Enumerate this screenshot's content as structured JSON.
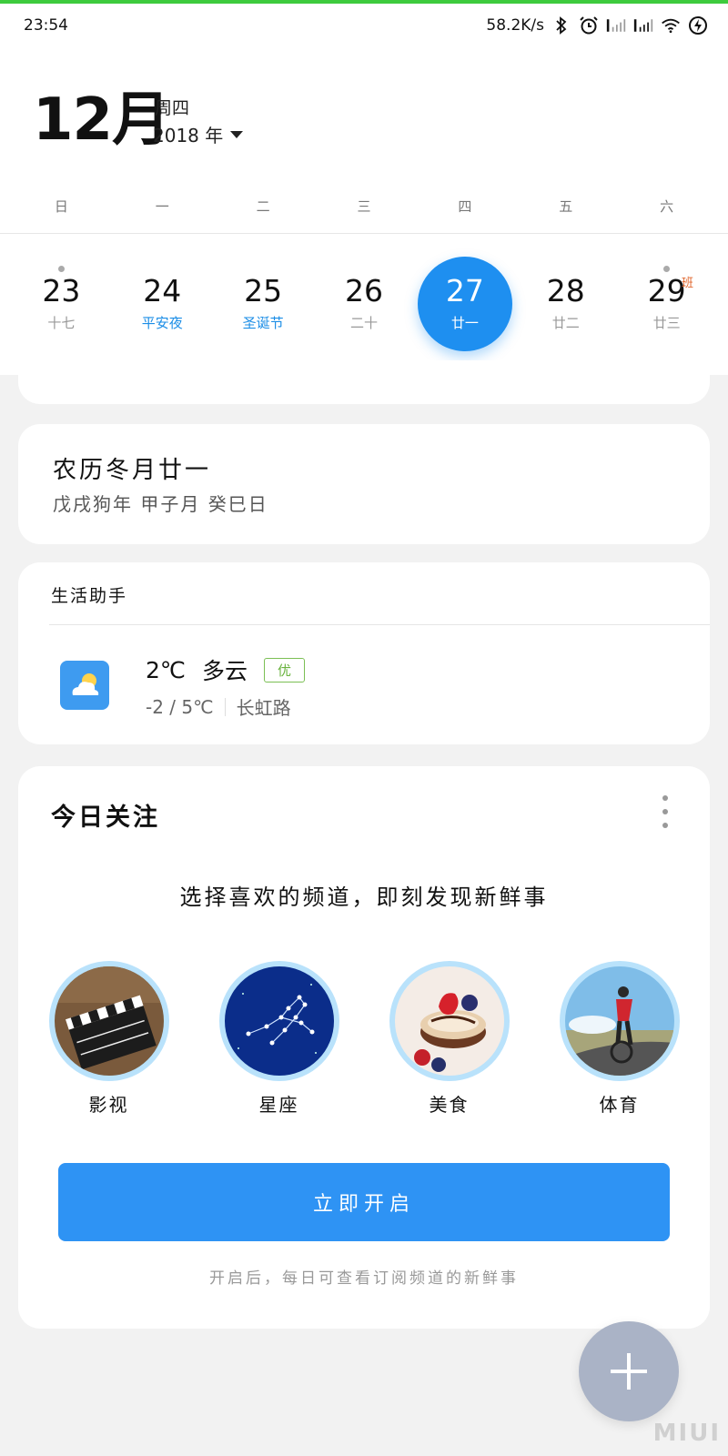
{
  "status_bar": {
    "time": "23:54",
    "net_speed": "58.2K/s",
    "icons": [
      "bluetooth-icon",
      "alarm-icon",
      "signal-icon",
      "signal-icon",
      "wifi-icon",
      "battery-charging-icon"
    ]
  },
  "header": {
    "month": "12月",
    "weekday": "周四",
    "year": "2018 年"
  },
  "weekdays": [
    "日",
    "一",
    "二",
    "三",
    "四",
    "五",
    "六"
  ],
  "dates": [
    {
      "num": "23",
      "sub": "十七",
      "festival": false,
      "dot": true,
      "badge": ""
    },
    {
      "num": "24",
      "sub": "平安夜",
      "festival": true,
      "dot": false,
      "badge": ""
    },
    {
      "num": "25",
      "sub": "圣诞节",
      "festival": true,
      "dot": false,
      "badge": ""
    },
    {
      "num": "26",
      "sub": "二十",
      "festival": false,
      "dot": false,
      "badge": ""
    },
    {
      "num": "27",
      "sub": "廿一",
      "festival": false,
      "dot": false,
      "badge": "",
      "selected": true
    },
    {
      "num": "28",
      "sub": "廿二",
      "festival": false,
      "dot": false,
      "badge": ""
    },
    {
      "num": "29",
      "sub": "廿三",
      "festival": false,
      "dot": true,
      "badge": "班"
    }
  ],
  "lunar": {
    "title": "农历冬月廿一",
    "ganzhi": "戊戌狗年 甲子月 癸巳日"
  },
  "life": {
    "title": "生活助手",
    "temp": "2℃",
    "condition": "多云",
    "aqi": "优",
    "range": "-2 / 5℃",
    "location": "长虹路"
  },
  "focus": {
    "title": "今日关注",
    "desc": "选择喜欢的频道，即刻发现新鲜事",
    "channels": [
      {
        "label": "影视",
        "icon": "clapperboard-icon"
      },
      {
        "label": "星座",
        "icon": "constellation-icon"
      },
      {
        "label": "美食",
        "icon": "dessert-icon"
      },
      {
        "label": "体育",
        "icon": "cyclist-icon"
      }
    ],
    "button": "立即开启",
    "hint": "开启后，每日可查看订阅频道的新鲜事"
  },
  "watermark": "MIUI",
  "colors": {
    "accent": "#1e8ff0",
    "festival": "#1b8de6",
    "badge": "#e0662d",
    "aqi_good": "#6ab33f",
    "fab": "#aab3c6"
  }
}
